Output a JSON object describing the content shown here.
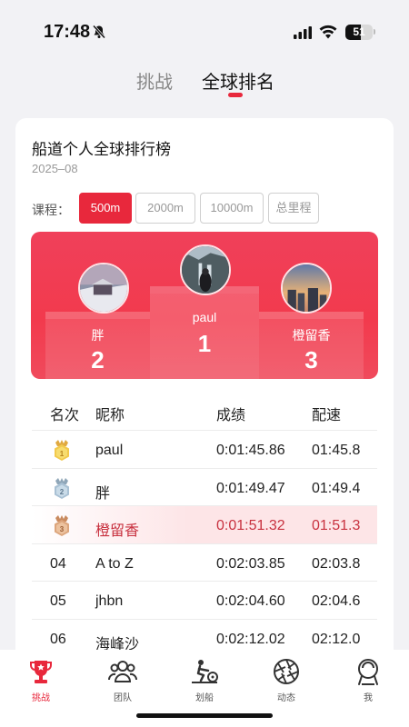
{
  "status_bar": {
    "time": "17:48",
    "battery": "51"
  },
  "top_tabs": [
    {
      "label": "挑战",
      "active": false
    },
    {
      "label": "全球排名",
      "active": true
    }
  ],
  "card": {
    "title": "船道个人全球排行榜",
    "date": "2025–08",
    "course_label": "课程：",
    "courses": [
      {
        "label": "500m",
        "active": true
      },
      {
        "label": "2000m",
        "active": false
      },
      {
        "label": "10000m",
        "active": false
      },
      {
        "label": "总里程",
        "active": false
      }
    ]
  },
  "podium": [
    {
      "name": "胖",
      "rank": "2"
    },
    {
      "name": "paul",
      "rank": "1"
    },
    {
      "name": "橙留香",
      "rank": "3"
    }
  ],
  "table": {
    "headers": {
      "rank": "名次",
      "name": "昵称",
      "score": "成绩",
      "pace": "配速"
    },
    "rows": [
      {
        "rank": "1",
        "name": "paul",
        "score": "0:01:45.86",
        "pace": "01:45.8",
        "medal": "gold"
      },
      {
        "rank": "2",
        "name": "胖",
        "score": "0:01:49.47",
        "pace": "01:49.4",
        "medal": "silver"
      },
      {
        "rank": "3",
        "name": "橙留香",
        "score": "0:01:51.32",
        "pace": "01:51.3",
        "medal": "bronze"
      },
      {
        "rank": "04",
        "name": "A to Z",
        "score": "0:02:03.85",
        "pace": "02:03.8"
      },
      {
        "rank": "05",
        "name": "jhbn",
        "score": "0:02:04.60",
        "pace": "02:04.6"
      },
      {
        "rank": "06",
        "name": "海峰沙",
        "score": "0:02:12.02",
        "pace": "02:12.0"
      }
    ]
  },
  "bottom_nav": [
    {
      "label": "挑战",
      "icon": "trophy-icon",
      "active": true
    },
    {
      "label": "团队",
      "icon": "team-icon",
      "active": false
    },
    {
      "label": "划船",
      "icon": "rowing-icon",
      "active": false
    },
    {
      "label": "动态",
      "icon": "aperture-icon",
      "active": false
    },
    {
      "label": "我",
      "icon": "profile-icon",
      "active": false
    }
  ],
  "colors": {
    "accent": "#e8283c",
    "highlight_row": "#fde5e7"
  }
}
